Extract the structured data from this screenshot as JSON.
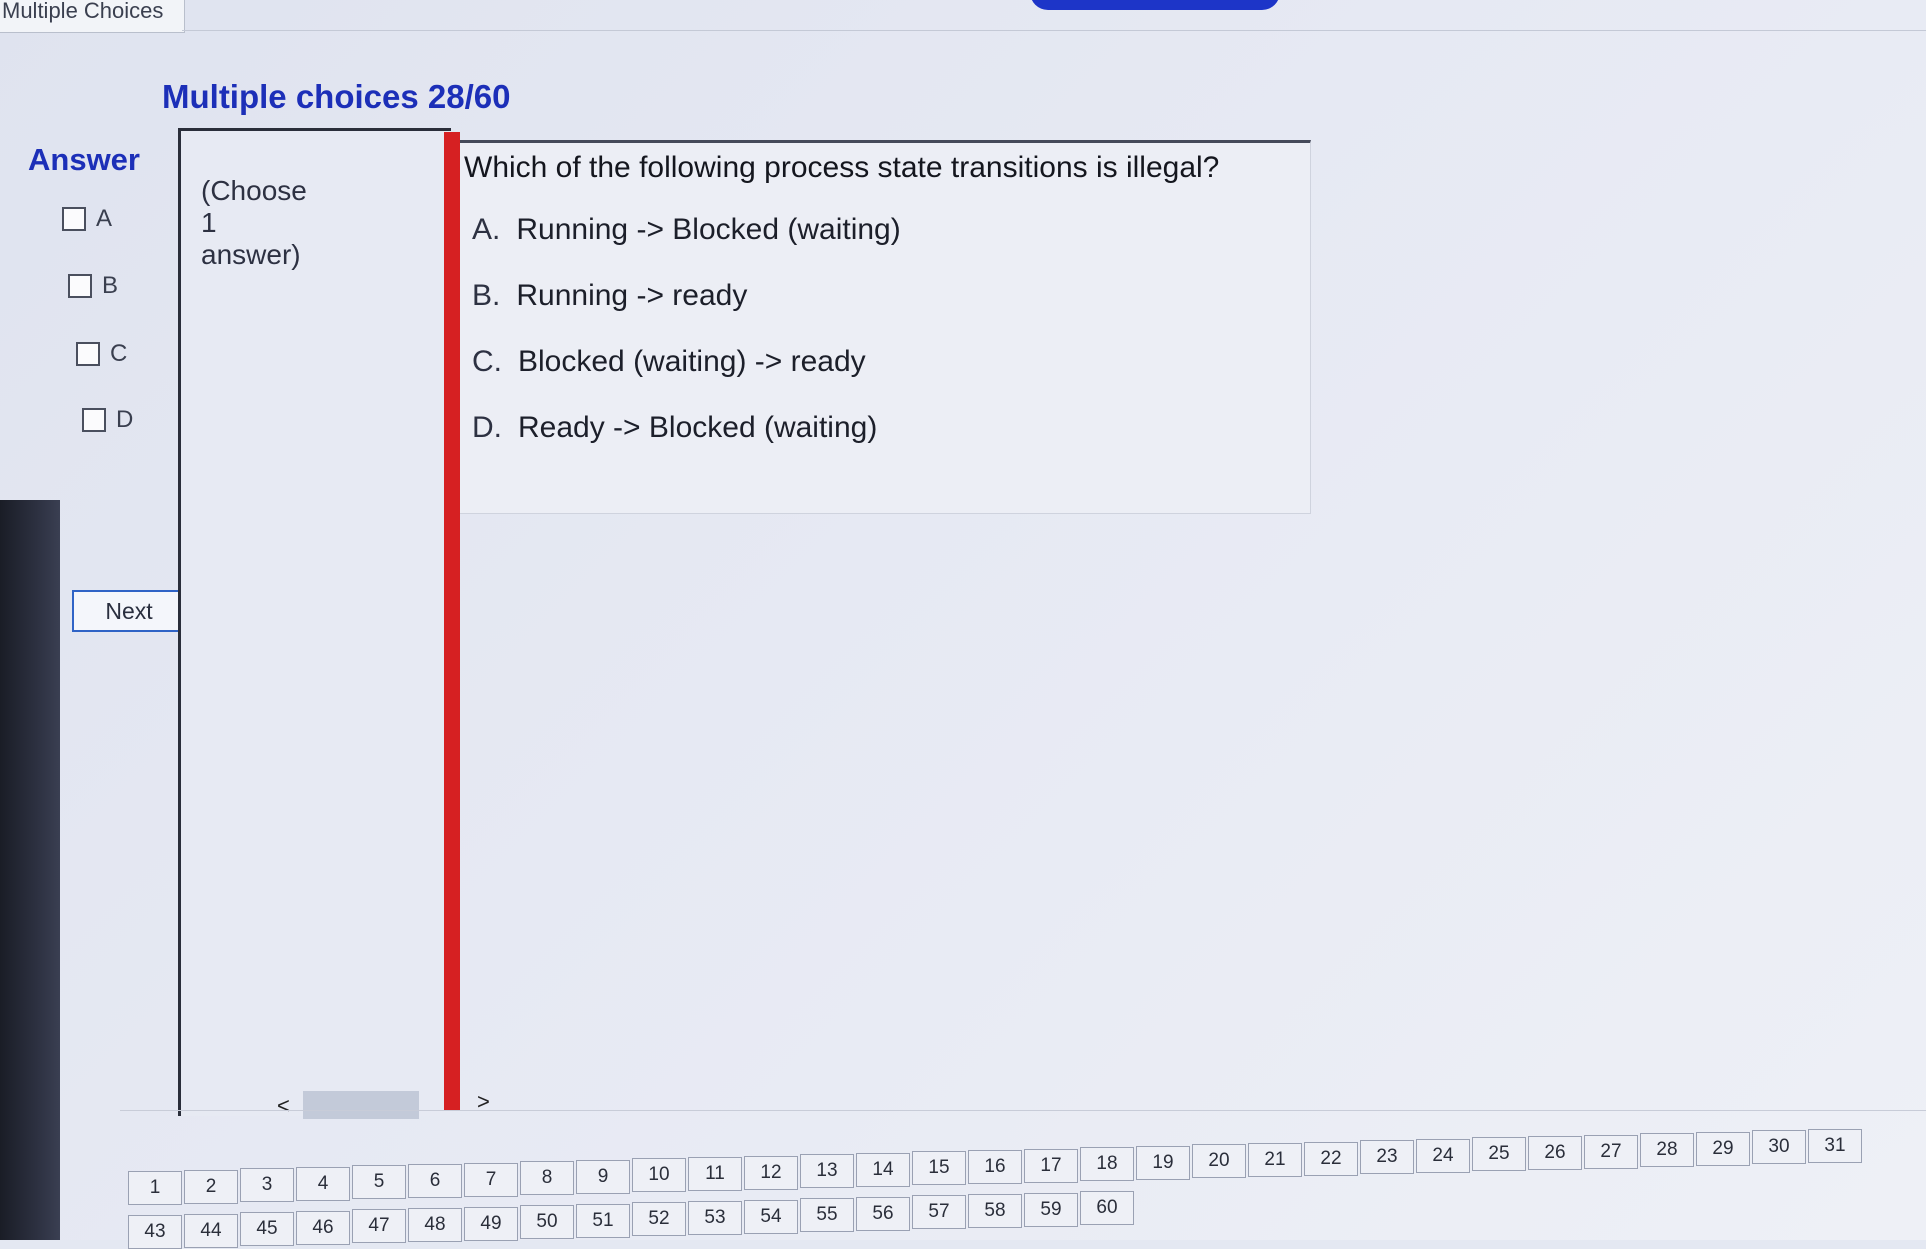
{
  "window": {
    "tab_title": "Multiple Choices"
  },
  "header": {
    "title": "Multiple choices 28/60"
  },
  "answer_panel": {
    "heading": "Answer",
    "options": [
      "A",
      "B",
      "C",
      "D"
    ],
    "next_label": "Next"
  },
  "instruction": {
    "line1": "(Choose",
    "line2": "1",
    "line3": "answer)"
  },
  "scrollbar": {
    "left_arrow": "<",
    "right_arrow": ">"
  },
  "question": {
    "text": "Which of the following process state transitions is illegal?",
    "choices": [
      {
        "letter": "A.",
        "text": "Running -> Blocked (waiting)"
      },
      {
        "letter": "B.",
        "text": "Running -> ready"
      },
      {
        "letter": "C.",
        "text": "Blocked (waiting)  -> ready"
      },
      {
        "letter": "D.",
        "text": "Ready -> Blocked (waiting)"
      }
    ]
  },
  "navigation": {
    "row1": [
      "1",
      "2",
      "3",
      "4",
      "5",
      "6",
      "7",
      "8",
      "9",
      "10",
      "11",
      "12",
      "13",
      "14",
      "15",
      "16",
      "17",
      "18",
      "19",
      "20",
      "21",
      "22",
      "23",
      "24",
      "25",
      "26",
      "27",
      "28",
      "29",
      "30",
      "31"
    ],
    "row2": [
      "43",
      "44",
      "45",
      "46",
      "47",
      "48",
      "49",
      "50",
      "51",
      "52",
      "53",
      "54",
      "55",
      "56",
      "57",
      "58",
      "59",
      "60"
    ]
  },
  "colors": {
    "accent_blue": "#1c2fb8",
    "divider_red": "#d62022"
  }
}
